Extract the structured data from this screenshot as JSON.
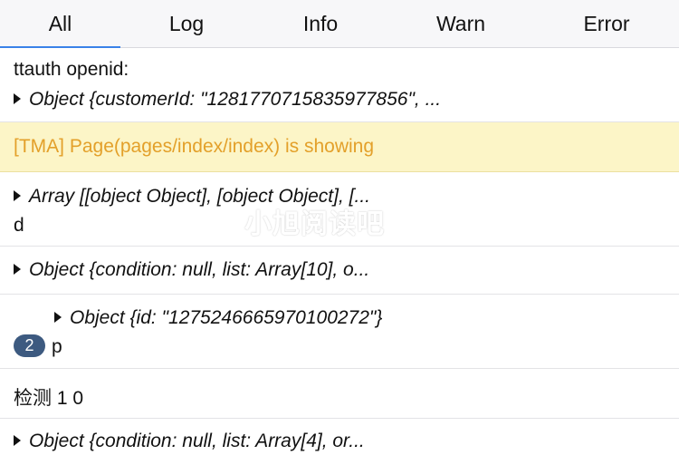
{
  "tabs": [
    {
      "label": "All",
      "active": true
    },
    {
      "label": "Log",
      "active": false
    },
    {
      "label": "Info",
      "active": false
    },
    {
      "label": "Warn",
      "active": false
    },
    {
      "label": "Error",
      "active": false
    }
  ],
  "accent_color": "#3a82e8",
  "warn_background": "#fcf5c7",
  "warn_text_color": "#e3a02a",
  "entries": [
    {
      "line1": "ttauth openid:",
      "line2": "Object {customerId: \"1281770715835977856\", ..."
    },
    {
      "line1": "[TMA] Page(pages/index/index) is showing",
      "level": "warn"
    },
    {
      "line1": "Array [[object Object], [object Object], [...",
      "line2": "d",
      "watermark": "小旭阅读吧"
    },
    {
      "line1": "Object {condition: null, list: Array[10], o..."
    },
    {
      "line1": "Object {id: \"1275246665970100272\"}",
      "badge": "2",
      "line2": "p"
    },
    {
      "line1": "检测 1 0"
    },
    {
      "line1": "Object {condition: null, list: Array[4], or..."
    }
  ],
  "icons": {
    "expand": "triangle-right-icon"
  }
}
